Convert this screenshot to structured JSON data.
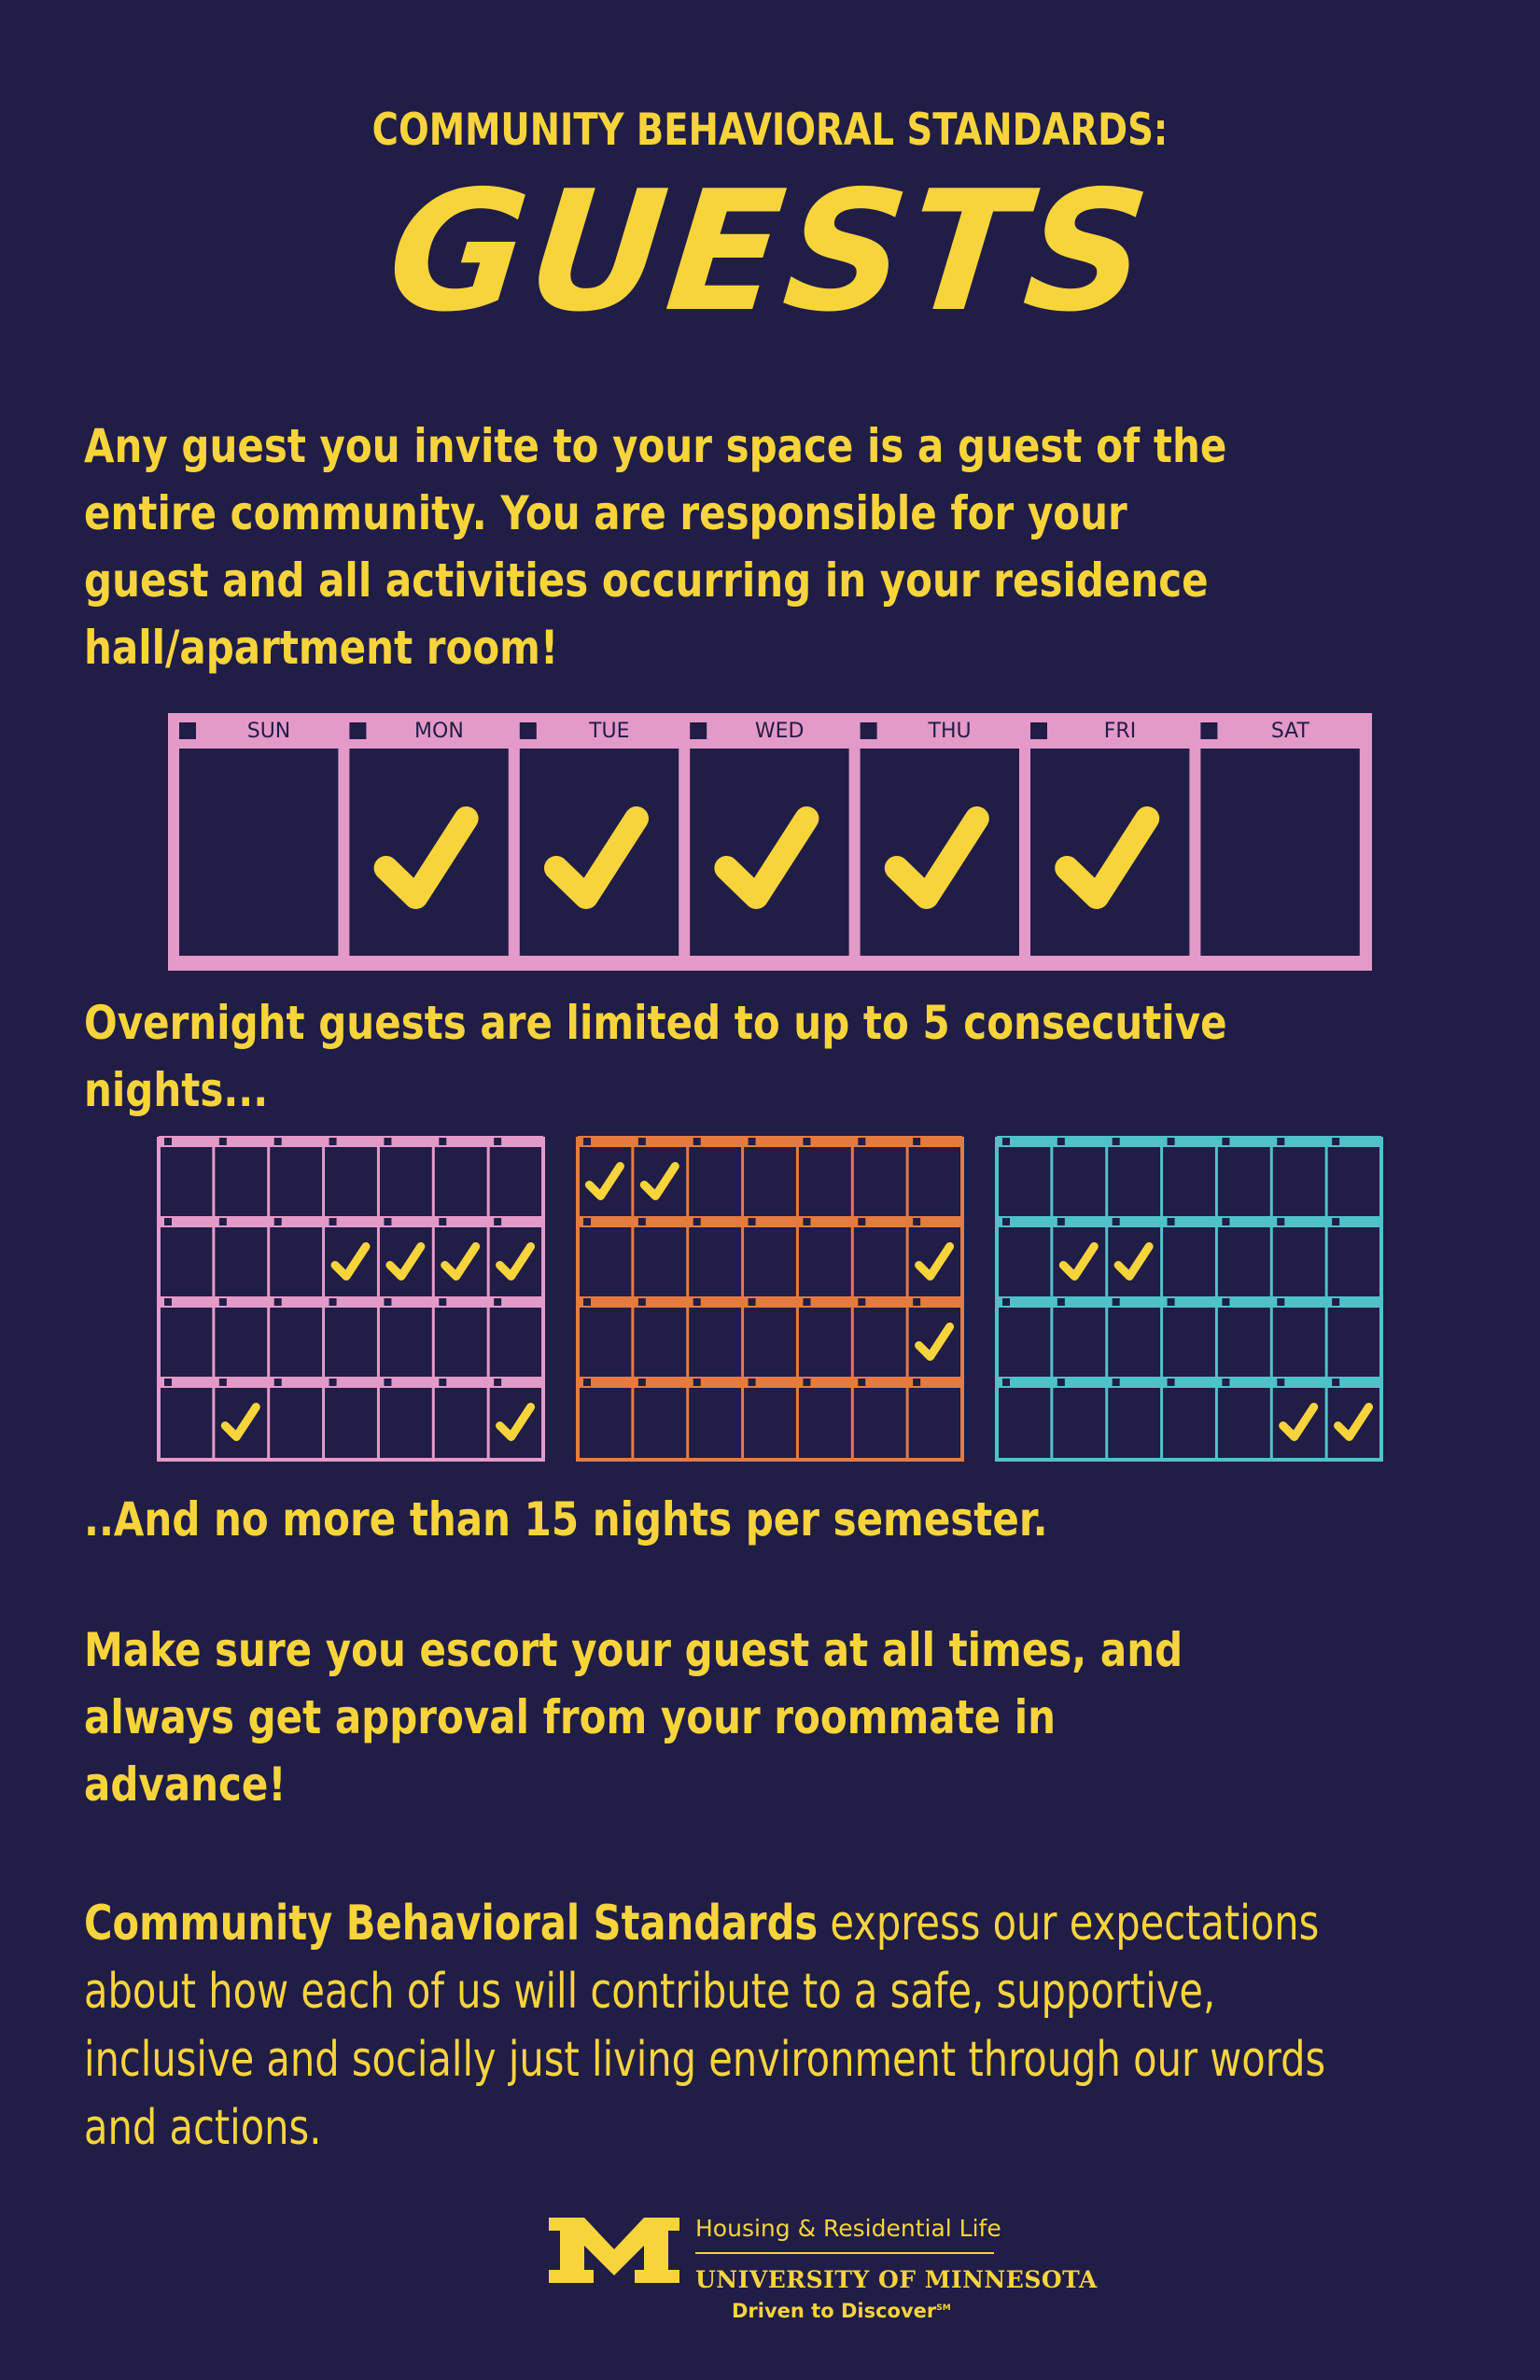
{
  "header": {
    "kicker": "COMMUNITY BEHAVIORAL STANDARDS:",
    "title": "GUESTS"
  },
  "intro": "Any guest you invite to your space is a guest of the entire community. You are responsible for your guest and all activities occurring in your residence hall/apartment room!",
  "week_calendar": {
    "days": [
      "SUN",
      "MON",
      "TUE",
      "WED",
      "THU",
      "FRI",
      "SAT"
    ],
    "checked": [
      false,
      true,
      true,
      true,
      true,
      true,
      false
    ],
    "color": "#e49ac8"
  },
  "limit_text": "Overnight guests are limited to up to 5 consecutive nights...",
  "month_calendars": [
    {
      "color": "#e49ac8",
      "checks": [
        [
          1,
          3
        ],
        [
          1,
          4
        ],
        [
          1,
          5
        ],
        [
          1,
          6
        ],
        [
          3,
          1
        ],
        [
          3,
          6
        ]
      ]
    },
    {
      "color": "#e67b3f",
      "checks": [
        [
          0,
          0
        ],
        [
          0,
          1
        ],
        [
          1,
          6
        ],
        [
          2,
          6
        ]
      ]
    },
    {
      "color": "#4fc2c9",
      "checks": [
        [
          1,
          1
        ],
        [
          1,
          2
        ],
        [
          3,
          5
        ],
        [
          3,
          6
        ]
      ]
    }
  ],
  "semester_text": "..And no more than 15 nights per semester.",
  "escort_text": "Make sure you escort your guest at all times, and always get approval from your roommate in advance!",
  "footer": {
    "lead": "Community Behavioral Standards",
    "body": " express our expectations about how each of us will contribute to a safe, supportive, inclusive and socially just living environment through our words and actions."
  },
  "logo": {
    "department": "Housing & Residential Life",
    "university": "UNIVERSITY OF MINNESOTA",
    "tagline": "Driven to Discover",
    "tagline_mark": "SM"
  },
  "colors": {
    "background": "#201d47",
    "text": "#f8d43b",
    "check": "#f8d43b"
  }
}
